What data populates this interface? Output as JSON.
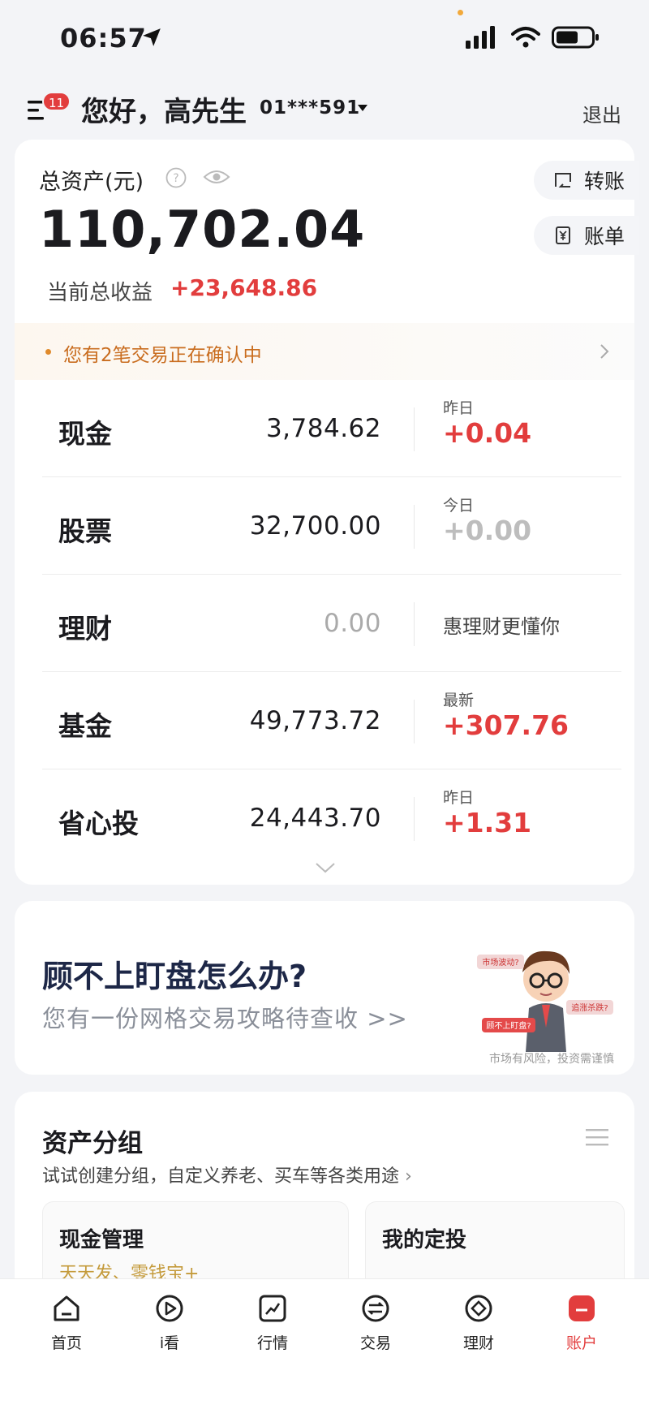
{
  "status_bar": {
    "time": "06:57"
  },
  "header": {
    "badge_count": "11",
    "greeting": "您好，高先生",
    "account_number": "01***591",
    "logout_label": "退出"
  },
  "assets": {
    "total_label": "总资产(元)",
    "total_value": "110,702.04",
    "profit_label": "当前总收益",
    "profit_value": "+23,648.86",
    "transfer_label": "转账",
    "bill_label": "账单",
    "pending_text": "您有2笔交易正在确认中",
    "rows": [
      {
        "name": "现金",
        "amount": "3,784.62",
        "sub": "昨日",
        "change": "+0.04"
      },
      {
        "name": "股票",
        "amount": "32,700.00",
        "sub": "今日",
        "change": "+0.00"
      },
      {
        "name": "理财",
        "amount": "0.00",
        "note": "惠理财更懂你"
      },
      {
        "name": "基金",
        "amount": "49,773.72",
        "sub": "最新",
        "change": "+307.76"
      },
      {
        "name": "省心投",
        "amount": "24,443.70",
        "sub": "昨日",
        "change": "+1.31"
      }
    ]
  },
  "promo": {
    "title": "顾不上盯盘怎么办?",
    "subtitle": "您有一份网格交易攻略待查收 >>",
    "risk_note": "市场有风险，投资需谨慎",
    "bubble_1": "市场波动?",
    "bubble_2": "追涨杀跌?",
    "bubble_3": "顾不上盯盘?"
  },
  "asset_group": {
    "title": "资产分组",
    "subtitle": "试试创建分组，自定义养老、买车等各类用途",
    "tiles": [
      {
        "title": "现金管理",
        "subtitle": "天天发、零钱宝+"
      },
      {
        "title": "我的定投",
        "subtitle": ""
      }
    ]
  },
  "tab_bar": {
    "items": [
      {
        "label": "首页",
        "icon": "home-icon"
      },
      {
        "label": "i看",
        "icon": "play-icon"
      },
      {
        "label": "行情",
        "icon": "chart-icon"
      },
      {
        "label": "交易",
        "icon": "swap-icon"
      },
      {
        "label": "理财",
        "icon": "diamond-icon"
      },
      {
        "label": "账户",
        "icon": "account-icon"
      }
    ],
    "active": "账户"
  },
  "colors": {
    "accent_red": "#e23d3d",
    "pending_orange": "#c96d1f",
    "tile_gold": "#c49a3a"
  }
}
